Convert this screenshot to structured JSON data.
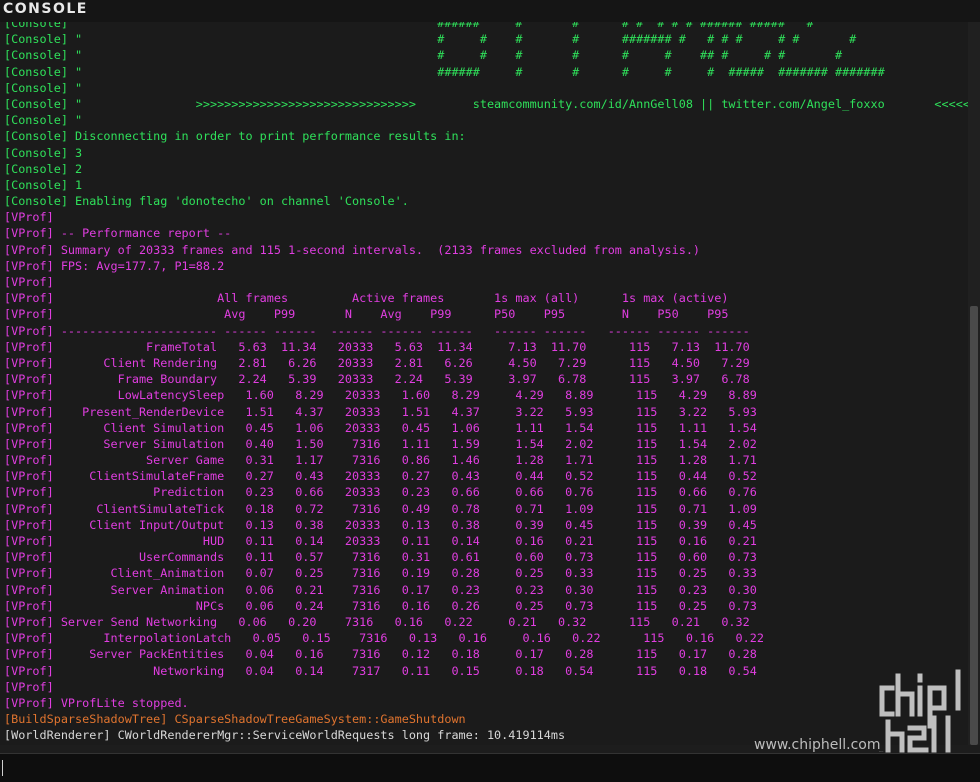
{
  "window": {
    "title": "CONSOLE"
  },
  "log_lines": [
    {
      "type": "console",
      "text": "[Console] \"                                                  ######     #       #      # #  # # # ###### #####   #"
    },
    {
      "type": "console",
      "text": "[Console] \"                                                  #     #    #       #      ####### #   # # #     # #       #"
    },
    {
      "type": "console",
      "text": "[Console] \"                                                  #     #    #       #      #     #    ## #     # #       #"
    },
    {
      "type": "console",
      "text": "[Console] \"                                                  ######     #       #      #     #     #  #####  ####### #######"
    },
    {
      "type": "console",
      "text": "[Console] \""
    },
    {
      "type": "console",
      "text": "[Console] \"                >>>>>>>>>>>>>>>>>>>>>>>>>>>>>>>        steamcommunity.com/id/AnnGell08 || twitter.com/Angel_foxxo       <<<<<<<<<<<<<<<<<<<<<<<<<<<<<<<"
    },
    {
      "type": "console",
      "text": "[Console] \""
    },
    {
      "type": "console",
      "text": "[Console] Disconnecting in order to print performance results in:"
    },
    {
      "type": "console",
      "text": "[Console] 3"
    },
    {
      "type": "console",
      "text": "[Console] 2"
    },
    {
      "type": "console",
      "text": "[Console] 1"
    },
    {
      "type": "console",
      "text": "[Console] Enabling flag 'donotecho' on channel 'Console'."
    },
    {
      "type": "vprof",
      "text": "[VProf]"
    },
    {
      "type": "vprof",
      "text": "[VProf] -- Performance report --"
    },
    {
      "type": "vprof",
      "text": "[VProf] Summary of 20333 frames and 115 1-second intervals.  (2133 frames excluded from analysis.)"
    },
    {
      "type": "vprof",
      "text": "[VProf] FPS: Avg=177.7, P1=88.2"
    },
    {
      "type": "vprof",
      "text": "[VProf]"
    },
    {
      "type": "vprof",
      "text": "[VProf]                       All frames         Active frames       1s max (all)      1s max (active)"
    },
    {
      "type": "vprof",
      "text": "[VProf]                        Avg    P99       N    Avg    P99      P50    P95        N    P50    P95"
    },
    {
      "type": "vprof",
      "text": "[VProf] ---------------------- ------ ------  ------ ------ ------   ------ ------   ------ ------ ------"
    },
    {
      "type": "vprof",
      "text": "[VProf]             FrameTotal   5.63  11.34   20333   5.63  11.34     7.13  11.70      115   7.13  11.70"
    },
    {
      "type": "vprof",
      "text": "[VProf]       Client Rendering   2.81   6.26   20333   2.81   6.26     4.50   7.29      115   4.50   7.29"
    },
    {
      "type": "vprof",
      "text": "[VProf]         Frame Boundary   2.24   5.39   20333   2.24   5.39     3.97   6.78      115   3.97   6.78"
    },
    {
      "type": "vprof",
      "text": "[VProf]         LowLatencySleep   1.60   8.29   20333   1.60   8.29     4.29   8.89      115   4.29   8.89"
    },
    {
      "type": "vprof",
      "text": "[VProf]    Present_RenderDevice   1.51   4.37   20333   1.51   4.37     3.22   5.93      115   3.22   5.93"
    },
    {
      "type": "vprof",
      "text": "[VProf]       Client Simulation   0.45   1.06   20333   0.45   1.06     1.11   1.54      115   1.11   1.54"
    },
    {
      "type": "vprof",
      "text": "[VProf]       Server Simulation   0.40   1.50    7316   1.11   1.59     1.54   2.02      115   1.54   2.02"
    },
    {
      "type": "vprof",
      "text": "[VProf]             Server Game   0.31   1.17    7316   0.86   1.46     1.28   1.71      115   1.28   1.71"
    },
    {
      "type": "vprof",
      "text": "[VProf]     ClientSimulateFrame   0.27   0.43   20333   0.27   0.43     0.44   0.52      115   0.44   0.52"
    },
    {
      "type": "vprof",
      "text": "[VProf]              Prediction   0.23   0.66   20333   0.23   0.66     0.66   0.76      115   0.66   0.76"
    },
    {
      "type": "vprof",
      "text": "[VProf]      ClientSimulateTick   0.18   0.72    7316   0.49   0.78     0.71   1.09      115   0.71   1.09"
    },
    {
      "type": "vprof",
      "text": "[VProf]     Client Input/Output   0.13   0.38   20333   0.13   0.38     0.39   0.45      115   0.39   0.45"
    },
    {
      "type": "vprof",
      "text": "[VProf]                     HUD   0.11   0.14   20333   0.11   0.14     0.16   0.21      115   0.16   0.21"
    },
    {
      "type": "vprof",
      "text": "[VProf]            UserCommands   0.11   0.57    7316   0.31   0.61     0.60   0.73      115   0.60   0.73"
    },
    {
      "type": "vprof",
      "text": "[VProf]        Client_Animation   0.07   0.25    7316   0.19   0.28     0.25   0.33      115   0.25   0.33"
    },
    {
      "type": "vprof",
      "text": "[VProf]        Server Animation   0.06   0.21    7316   0.17   0.23     0.23   0.30      115   0.23   0.30"
    },
    {
      "type": "vprof",
      "text": "[VProf]                    NPCs   0.06   0.24    7316   0.16   0.26     0.25   0.73      115   0.25   0.73"
    },
    {
      "type": "vprof",
      "text": "[VProf] Server Send Networking   0.06   0.20    7316   0.16   0.22     0.21   0.32      115   0.21   0.32"
    },
    {
      "type": "vprof",
      "text": "[VProf]       InterpolationLatch   0.05   0.15    7316   0.13   0.16     0.16   0.22      115   0.16   0.22"
    },
    {
      "type": "vprof",
      "text": "[VProf]     Server PackEntities   0.04   0.16    7316   0.12   0.18     0.17   0.28      115   0.17   0.28"
    },
    {
      "type": "vprof",
      "text": "[VProf]              Networking   0.04   0.14    7317   0.11   0.15     0.18   0.54      115   0.18   0.54"
    },
    {
      "type": "vprof",
      "text": "[VProf]"
    },
    {
      "type": "vprof",
      "text": "[VProf] VProfLite stopped."
    },
    {
      "type": "build",
      "text": "[BuildSparseShadowTree] CSparseShadowTreeGameSystem::GameShutdown"
    },
    {
      "type": "world",
      "text": "[WorldRenderer] CWorldRendererMgr::ServiceWorldRequests long frame: 10.419114ms"
    }
  ],
  "input": {
    "value": "",
    "placeholder": ""
  },
  "watermark": {
    "text": "www.chiphell.com",
    "logo_text": "chip hell"
  },
  "colors": {
    "console": "#2fe05a",
    "vprof": "#e03ee0",
    "build": "#e0742f",
    "world": "#d8d8d8",
    "background": "#1b1b1b"
  }
}
